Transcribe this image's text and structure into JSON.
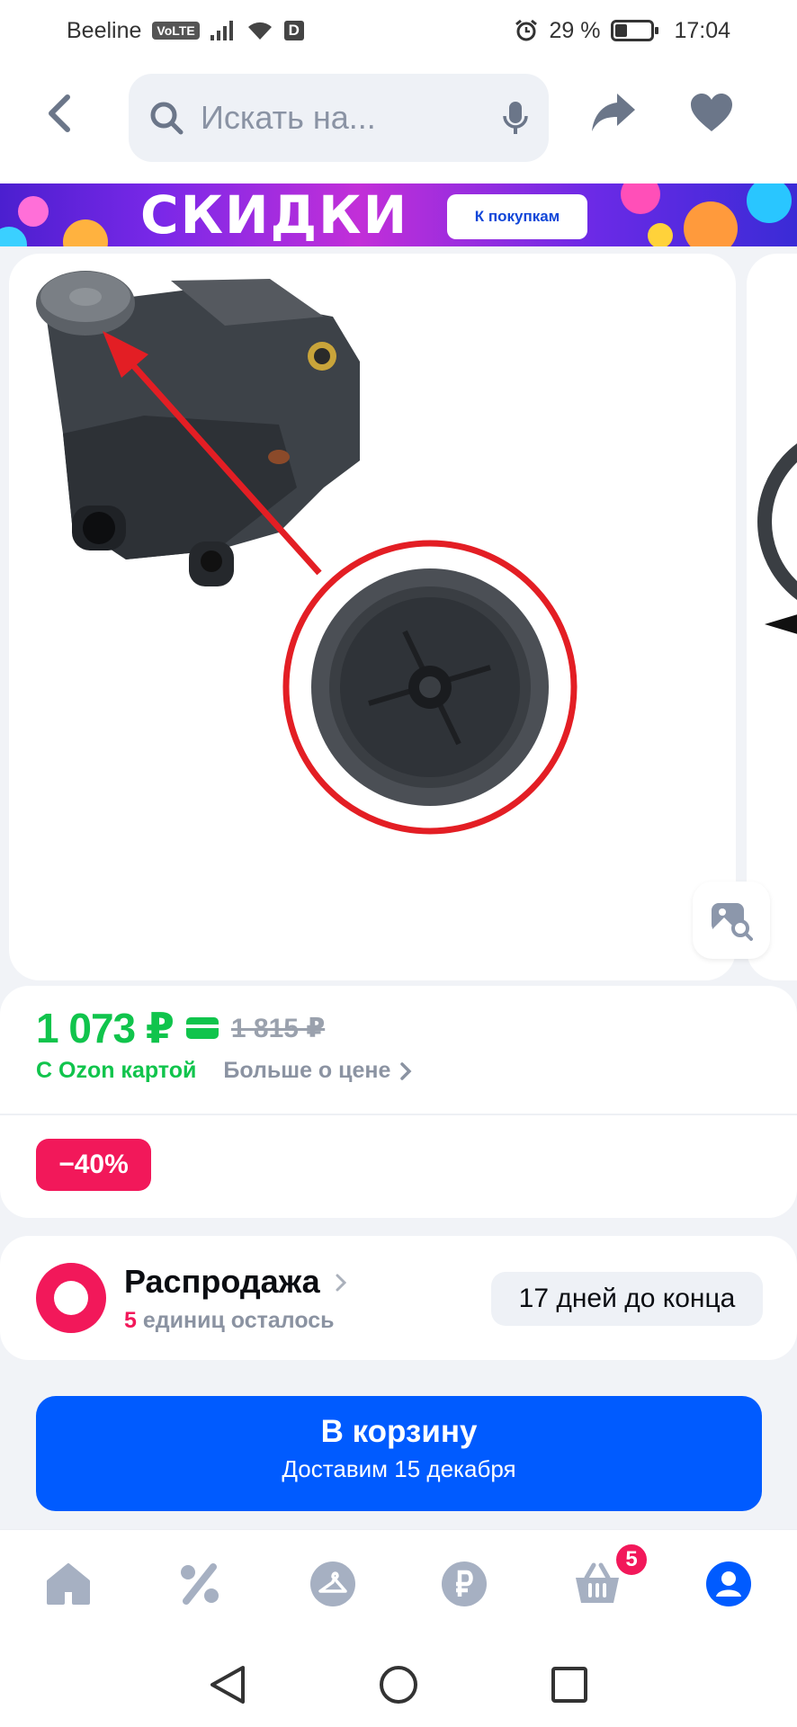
{
  "status_bar": {
    "carrier": "Beeline",
    "volte": "VoLTE",
    "data_badge": "D",
    "battery": "29 %",
    "battery_level": 0.29,
    "time": "17:04"
  },
  "header": {
    "search_placeholder": "Искать на...",
    "icons": [
      "back-arrow-icon",
      "search-icon",
      "mic-icon",
      "share-icon",
      "heart-icon"
    ]
  },
  "banner": {
    "title": "СКИДКИ",
    "button_label": "К покупкам"
  },
  "product": {
    "price_now": "1 073 ₽",
    "price_old": "1 815 ₽",
    "ozon_card_label": "С Ozon картой",
    "more_about_price": "Больше о цене",
    "discount_badge": "−40%"
  },
  "sale": {
    "title": "Распродажа",
    "units_count": "5",
    "units_text": "единиц осталось",
    "deadline": "17 дней до конца"
  },
  "cart_button": {
    "label": "В корзину",
    "delivery": "Доставим 15 декабря"
  },
  "tabbar": {
    "cart_badge": "5",
    "tabs": [
      "home-icon",
      "percent-icon",
      "hanger-icon",
      "ruble-icon",
      "basket-icon",
      "profile-icon"
    ]
  },
  "colors": {
    "accent_blue": "#005bff",
    "price_green": "#10c44c",
    "pink": "#f2185a",
    "nav_icon": "#a6b0c2"
  }
}
